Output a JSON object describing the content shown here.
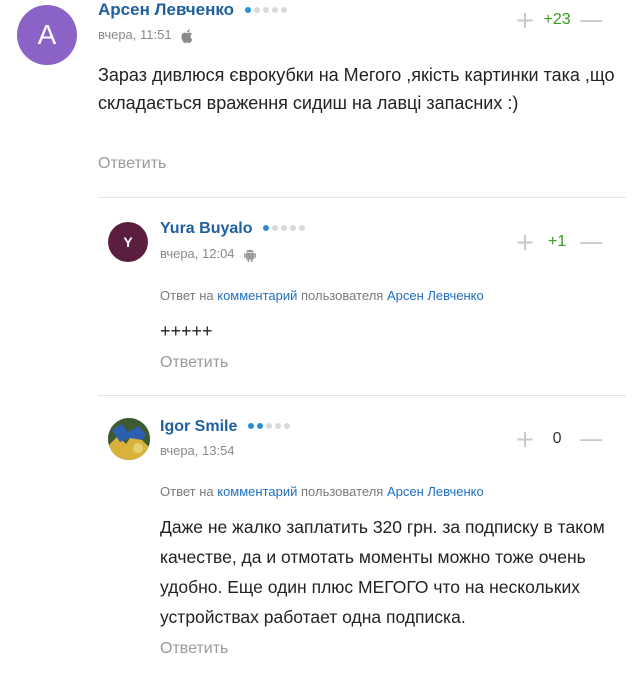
{
  "comments": [
    {
      "avatar_letter": "А",
      "avatar_color": "#8b63c7",
      "author": "Арсен Левченко",
      "rating_dots": 1,
      "time": "вчера, 11:51",
      "os_icon": "apple-icon",
      "score": "+23",
      "text": "Зараз дивлюся єврокубки на Мегого ,якість картинки така ,що складається враження сидиш на лавці запасних :)",
      "reply_label": "Ответить"
    },
    {
      "avatar_letter": "Y",
      "avatar_color": "#5a1f3f",
      "author": "Yura Buyalo",
      "rating_dots": 1,
      "time": "вчера, 12:04",
      "os_icon": "android-icon",
      "score": "+1",
      "reply_prefix": "Ответ на",
      "reply_comment_link": "комментарий",
      "reply_middle": "пользователя",
      "reply_user": "Арсен Левченко",
      "text": "+++++",
      "reply_label": "Ответить"
    },
    {
      "avatar_letter": "",
      "avatar_color": "#4a6a3a",
      "author": "Igor Smile",
      "rating_dots": 2,
      "time": "вчера, 13:54",
      "score": "0",
      "reply_prefix": "Ответ на",
      "reply_comment_link": "комментарий",
      "reply_middle": "пользователя",
      "reply_user": "Арсен Левченко",
      "text": "Даже не жалко заплатить 320 грн. за подписку в таком качестве, да и отмотать моменты можно тоже очень удобно. Еще один плюс МЕГОГО что на нескольких устройствах работает одна подписка.",
      "reply_label": "Ответить"
    }
  ],
  "controls": {
    "plus": "+",
    "minus": "—"
  }
}
